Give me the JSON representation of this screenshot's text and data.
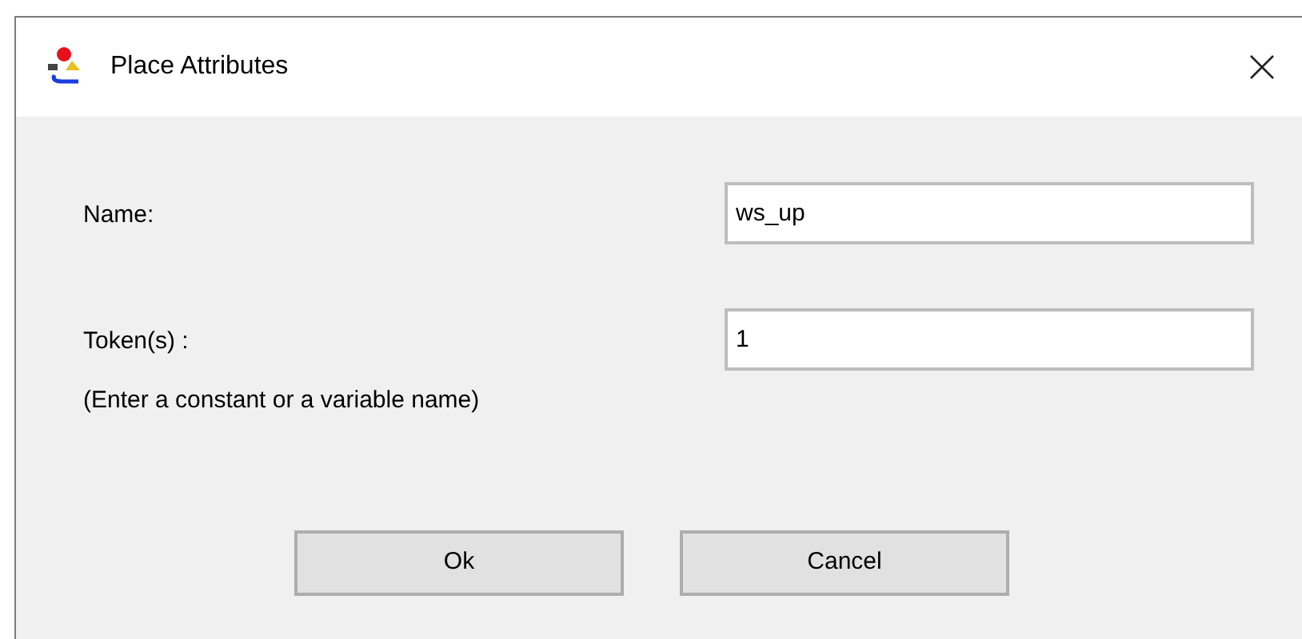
{
  "window": {
    "title": "Place Attributes"
  },
  "fields": [
    {
      "label": "Name:",
      "value": "ws_up"
    },
    {
      "label": "Token(s) :",
      "hint": "(Enter a constant or a variable name)",
      "value": "1"
    }
  ],
  "buttons": [
    "Ok",
    "Cancel"
  ]
}
